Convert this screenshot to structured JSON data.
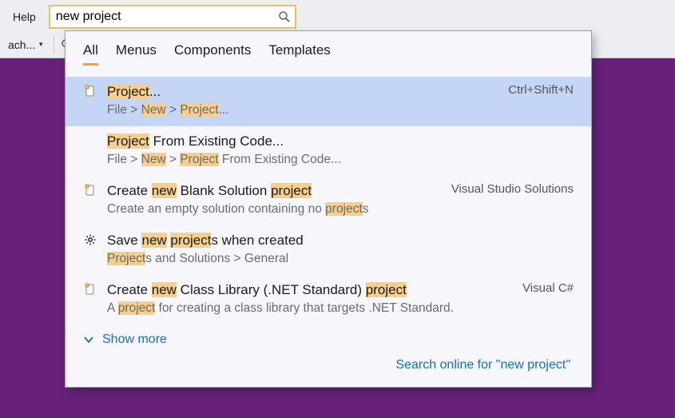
{
  "menu": {
    "help": "Help"
  },
  "search": {
    "value": "new project",
    "placeholder": ""
  },
  "toolbar": {
    "attach_fragment": "ach...",
    "arrow_left": "↶"
  },
  "popup": {
    "tabs": [
      "All",
      "Menus",
      "Components",
      "Templates"
    ],
    "active_tab": 0,
    "results": [
      {
        "icon": "doc",
        "title_segments": [
          [
            "Project",
            true
          ],
          [
            "...",
            false
          ]
        ],
        "path_segments": [
          [
            "File > ",
            false
          ],
          [
            "New",
            true
          ],
          [
            " > ",
            false
          ],
          [
            "Project",
            true
          ],
          [
            "...",
            false
          ]
        ],
        "right": "Ctrl+Shift+N",
        "selected": true
      },
      {
        "icon": "",
        "title_segments": [
          [
            "Project",
            true
          ],
          [
            " From Existing Code...",
            false
          ]
        ],
        "path_segments": [
          [
            "File > ",
            false
          ],
          [
            "New",
            true
          ],
          [
            " > ",
            false
          ],
          [
            "Project",
            true
          ],
          [
            " From Existing Code...",
            false
          ]
        ],
        "right": ""
      },
      {
        "icon": "doc",
        "title_segments": [
          [
            "Create ",
            false
          ],
          [
            "new",
            true
          ],
          [
            " Blank Solution ",
            false
          ],
          [
            "project",
            true
          ]
        ],
        "path_segments": [
          [
            "Create an empty solution containing no ",
            false
          ],
          [
            "project",
            true
          ],
          [
            "s",
            false
          ]
        ],
        "right": "Visual Studio Solutions"
      },
      {
        "icon": "gear",
        "title_segments": [
          [
            "Save ",
            false
          ],
          [
            "new",
            true
          ],
          [
            " ",
            false
          ],
          [
            "project",
            true
          ],
          [
            "s when created",
            false
          ]
        ],
        "path_segments": [
          [
            "Project",
            true
          ],
          [
            "s and Solutions > General",
            false
          ]
        ],
        "right": ""
      },
      {
        "icon": "doc",
        "title_segments": [
          [
            "Create ",
            false
          ],
          [
            "new",
            true
          ],
          [
            " Class Library (.NET Standard) ",
            false
          ],
          [
            "project",
            true
          ]
        ],
        "path_segments": [
          [
            "A ",
            false
          ],
          [
            "project",
            true
          ],
          [
            " for creating a class library that targets .NET Standard.",
            false
          ]
        ],
        "right": "Visual C#"
      }
    ],
    "show_more": "Show more",
    "online_prefix": "Search online for \"",
    "online_term": "new project",
    "online_suffix": "\""
  }
}
